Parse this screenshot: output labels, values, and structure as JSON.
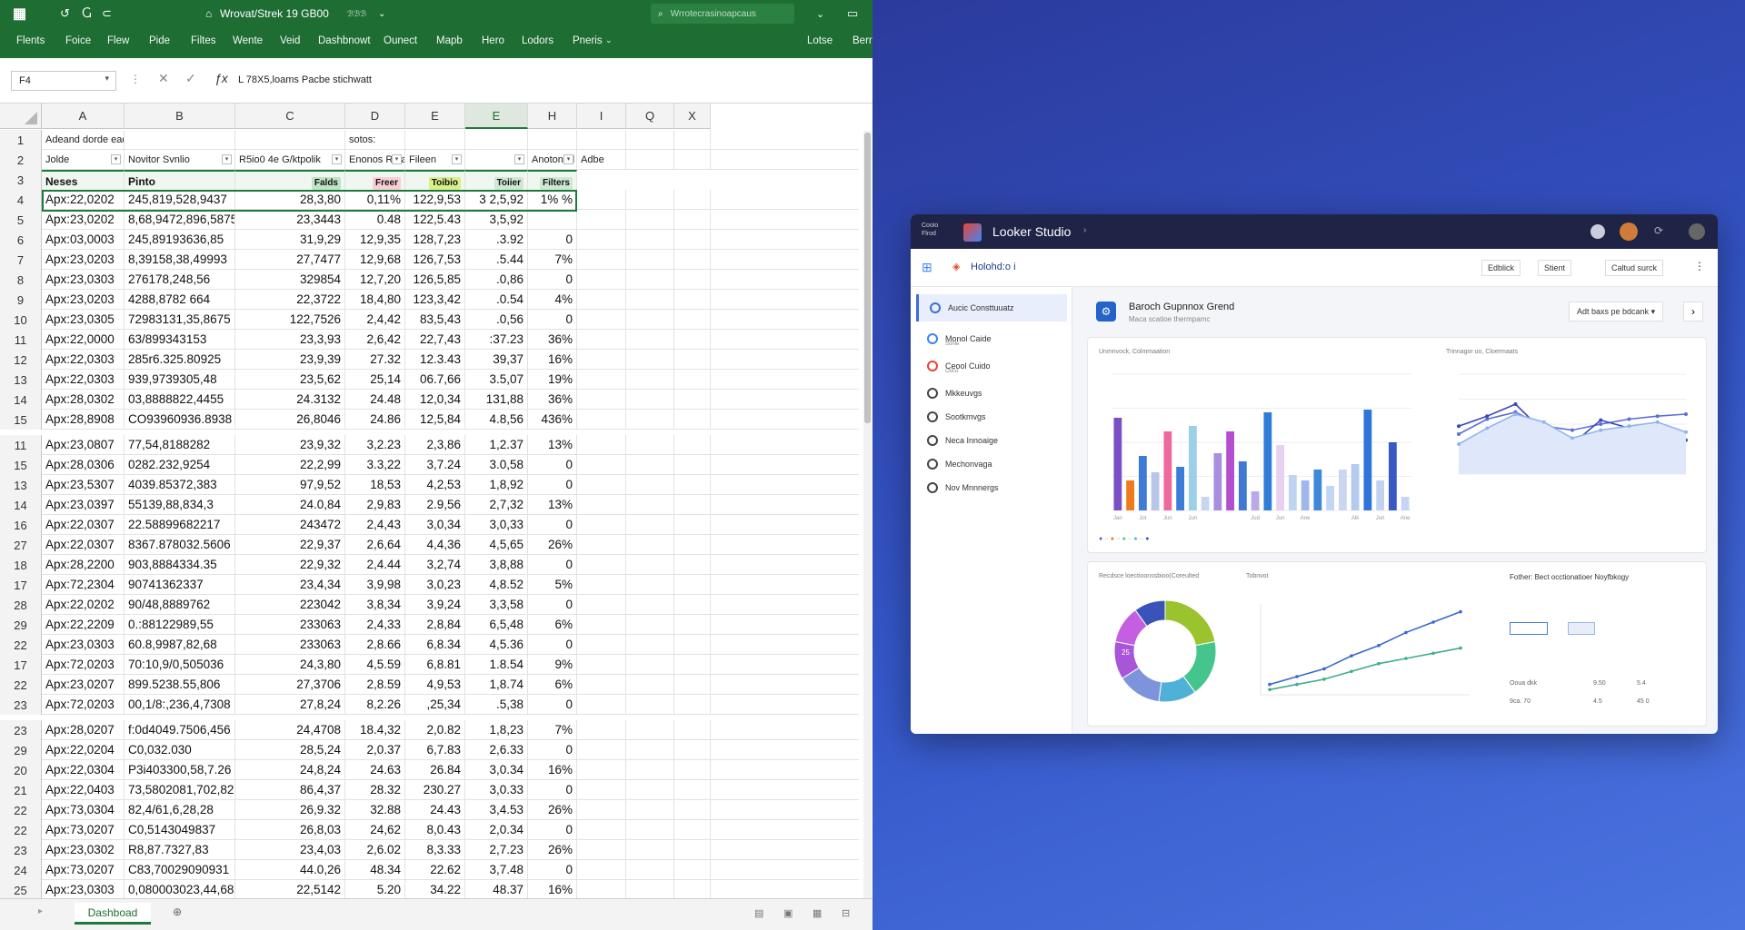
{
  "excel": {
    "title": "Wrovat/Strek 19 GB00",
    "title_badge": "ℬℬℬ",
    "search_placeholder": "Wrrotecrasinoapcaus",
    "menu": [
      "Flents",
      "Foice",
      "Flew",
      "Pide",
      "Filtes",
      "Wente",
      "Veid",
      "Dashbnowt",
      "Ounect",
      "Mapb",
      "Hero",
      "Lodors",
      "Pneris"
    ],
    "menu_right": [
      "Lotse",
      "Berr"
    ],
    "name_box": "F4",
    "formula": "L 78X5,loams Pacbe stichwatt",
    "columns": [
      "A",
      "B",
      "C",
      "D",
      "E",
      "E",
      "H",
      "I",
      "Q",
      "X"
    ],
    "row1": [
      "Adeand dorde eadas",
      "",
      "",
      "sotos:"
    ],
    "row2": [
      "Jolde",
      "Novitor Svnlio",
      "R5io0 4e G/ktpolik",
      "Enonos Rotay",
      "Fileen",
      "",
      "Anotonad",
      "Adbe"
    ],
    "row3": {
      "a": "Neses",
      "b": "Pinto",
      "c": "Falds",
      "d": "Freer",
      "e": "Toibio",
      "f": "Toiier",
      "g": "Filters"
    },
    "rows": [
      {
        "n": "4",
        "a": "Apx:22,0202",
        "b": "245,819,528,9437",
        "c": "28,3,80",
        "d": "0,11%",
        "e": "122,9,53",
        "f": "3 2,5,92",
        "g": "1% %"
      },
      {
        "n": "5",
        "a": "Apx:23,0202",
        "b": "8,68,9472,896,5875",
        "c": "23,3443",
        "d": "0.48",
        "e": "122,5.43",
        "f": "3,5,92",
        "g": ""
      },
      {
        "n": "6",
        "a": "Apx:03,0003",
        "b": "245,89193636,85",
        "c": "31,9,29",
        "d": "12,9,35",
        "e": "128,7,23",
        "f": ".3.92",
        "g": "0"
      },
      {
        "n": "7",
        "a": "Apx:23,0203",
        "b": "8,39158,38,49993",
        "c": "27,7477",
        "d": "12,9,68",
        "e": "126,7,53",
        "f": ".5.44",
        "g": "7%"
      },
      {
        "n": "8",
        "a": "Apx:23,0303",
        "b": "276178,248,56",
        "c": "329854",
        "d": "12,7,20",
        "e": "126,5,85",
        "f": ".0,86",
        "g": "0"
      },
      {
        "n": "9",
        "a": "Apx:23,0203",
        "b": "4288,8782 664",
        "c": "22,3722",
        "d": "18,4,80",
        "e": "123,3,42",
        "f": ".0.54",
        "g": "4%"
      },
      {
        "n": "10",
        "a": "Apx:23,0305",
        "b": "72983131,35,8675",
        "c": "122,7526",
        "d": "2,4,42",
        "e": "83,5,43",
        "f": ".0,56",
        "g": "0"
      },
      {
        "n": "11",
        "a": "Apx:22,0000",
        "b": "63/899343153",
        "c": "23,3,93",
        "d": "2,6,42",
        "e": "22,7,43",
        "f": ":37.23",
        "g": "36%"
      },
      {
        "n": "12",
        "a": "Apx:22,0303",
        "b": "285r6.325.80925",
        "c": "23,9,39",
        "d": "27.32",
        "e": "12.3.43",
        "f": "39,37",
        "g": "16%"
      },
      {
        "n": "13",
        "a": "Apx:22,0303",
        "b": "939,9739305,48",
        "c": "23,5,62",
        "d": "25,14",
        "e": "06.7,66",
        "f": "3.5,07",
        "g": "19%"
      },
      {
        "n": "14",
        "a": "Apx:28,0302",
        "b": "03,8888822,4455",
        "c": "24.3132",
        "d": "24.48",
        "e": "12,0,34",
        "f": "131,88",
        "g": "36%"
      },
      {
        "n": "15",
        "a": "Apx:28,8908",
        "b": "CO93960936.8938",
        "c": "26,8046",
        "d": "24.86",
        "e": "12,5,84",
        "f": "4.8,56",
        "g": "436%"
      },
      {
        "n": "11",
        "a": "Apx:23,0807",
        "b": "77,54,8188282",
        "c": "23,9,32",
        "d": "3,2.23",
        "e": "2,3,86",
        "f": "1,2.37",
        "g": "13%"
      },
      {
        "n": "15",
        "a": "Apx:28,0306",
        "b": "0282.232,9254",
        "c": "22,2,99",
        "d": "3.3,22",
        "e": "3,7.24",
        "f": "3.0,58",
        "g": "0"
      },
      {
        "n": "13",
        "a": "Apx:23,5307",
        "b": "4039.85372,383",
        "c": "97,9,52",
        "d": "18,53",
        "e": "4,2,53",
        "f": "1,8,92",
        "g": "0"
      },
      {
        "n": "14",
        "a": "Apx:23,0397",
        "b": "55139,88,834,3",
        "c": "24.0,84",
        "d": "2,9,83",
        "e": "2.9,56",
        "f": "2,7,32",
        "g": "13%"
      },
      {
        "n": "16",
        "a": "Apx:22,0307",
        "b": "22.58899682217",
        "c": "243472",
        "d": "2,4,43",
        "e": "3,0,34",
        "f": "3,0,33",
        "g": "0"
      },
      {
        "n": "27",
        "a": "Apx:22,0307",
        "b": "8367.878032.5606",
        "c": "22,9,37",
        "d": "2,6,64",
        "e": "4,4,36",
        "f": "4,5,65",
        "g": "26%"
      },
      {
        "n": "18",
        "a": "Apx:28,2200",
        "b": "903,8884334.35",
        "c": "22,9,32",
        "d": "2,4.44",
        "e": "3,2,74",
        "f": "3,8,88",
        "g": "0"
      },
      {
        "n": "17",
        "a": "Apx:72,2304",
        "b": "90741362337",
        "c": "23,4,34",
        "d": "3,9,98",
        "e": "3,0,23",
        "f": "4,8.52",
        "g": "5%"
      },
      {
        "n": "28",
        "a": "Apx:22,0202",
        "b": "90/48,8889762",
        "c": "223042",
        "d": "3,8,34",
        "e": "3,9,24",
        "f": "3,3,58",
        "g": "0"
      },
      {
        "n": "29",
        "a": "Apx:22,2209",
        "b": "0.:88122989,55",
        "c": "233063",
        "d": "2,4,33",
        "e": "2,8,84",
        "f": "6,5,48",
        "g": "6%"
      },
      {
        "n": "22",
        "a": "Apx:23,0303",
        "b": "60.8,9987,82,68",
        "c": "233063",
        "d": "2,8.66",
        "e": "6,8.34",
        "f": "4,5.36",
        "g": "0"
      },
      {
        "n": "17",
        "a": "Apx:72,0203",
        "b": "70:10,9/0,505036",
        "c": "24,3,80",
        "d": "4,5.59",
        "e": "6,8.81",
        "f": "1.8.54",
        "g": "9%"
      },
      {
        "n": "22",
        "a": "Apx:23,0207",
        "b": "899.5238.55,806",
        "c": "27,3706",
        "d": "2,8.59",
        "e": "4,9,53",
        "f": "1,8.74",
        "g": "6%"
      },
      {
        "n": "23",
        "a": "Apx:72,0203",
        "b": "00,1/8:,236,4,7308",
        "c": "27,8,24",
        "d": "8,2.26",
        "e": ",25,34",
        "f": ".5,38",
        "g": "0"
      },
      {
        "n": "23",
        "a": "Apx:28,0207",
        "b": "f:0d4049.7506,456",
        "c": "24,4708",
        "d": "18.4,32",
        "e": "2,0.82",
        "f": "1,8,23",
        "g": "7%"
      },
      {
        "n": "29",
        "a": "Apx:22,0204",
        "b": "C0,032.030",
        "c": "28,5,24",
        "d": "2,0.37",
        "e": "6,7.83",
        "f": "2,6.33",
        "g": "0"
      },
      {
        "n": "20",
        "a": "Apx:22,0304",
        "b": "P3i403300,58,7.26",
        "c": "24,8,24",
        "d": "24.63",
        "e": "26.84",
        "f": "3,0.34",
        "g": "16%"
      },
      {
        "n": "21",
        "a": "Apx:22,0403",
        "b": "73,5802081,702,82,06",
        "c": "86,4,37",
        "d": "28.32",
        "e": "230.27",
        "f": "3,0.33",
        "g": "0"
      },
      {
        "n": "22",
        "a": "Apx:73,0304",
        "b": "82,4/61,6,28,28",
        "c": "26,9.32",
        "d": "32.88",
        "e": "24.43",
        "f": "3,4.53",
        "g": "26%"
      },
      {
        "n": "22",
        "a": "Apx:73,0207",
        "b": "C0,5143049837",
        "c": "26,8,03",
        "d": "24,62",
        "e": "8,0.43",
        "f": "2,0.34",
        "g": "0"
      },
      {
        "n": "23",
        "a": "Apx:23,0302",
        "b": "R8,87.7327,83",
        "c": "23,4,03",
        "d": "2,6.02",
        "e": "8,3.33",
        "f": "2,7.23",
        "g": "26%"
      },
      {
        "n": "24",
        "a": "Apx:73,0207",
        "b": "C83,70029090931",
        "c": "44.0,26",
        "d": "48.34",
        "e": "22.62",
        "f": "3,7.48",
        "g": "0"
      },
      {
        "n": "25",
        "a": "Apx:23,0303",
        "b": "0,080003023,44,681",
        "c": "22,5142",
        "d": "5.20",
        "e": "34.22",
        "f": "48.37",
        "g": "16%"
      }
    ],
    "sheet_tab": "Dashboad"
  },
  "looker": {
    "brand_small": "Coolo Flrod",
    "title": "Looker Studio",
    "report_name": "Holohd:o i",
    "tool_buttons": [
      "Edblick",
      "Stient",
      "Caltud surck"
    ],
    "sidebar": [
      {
        "label": "Aucic Consttuuatz",
        "sub": "",
        "color": "#3b6fd6"
      },
      {
        "label": "Monol Caide",
        "sub": "Sonie",
        "color": "#3b82f6"
      },
      {
        "label": "Ceool Cuido",
        "sub": "Ooco",
        "color": "#ea4335"
      },
      {
        "label": "Mkkeuvgs",
        "sub": "",
        "color": "#444"
      },
      {
        "label": "Sootkmvgs",
        "sub": "",
        "color": "#444"
      },
      {
        "label": "Neca Innoaige",
        "sub": "",
        "color": "#444"
      },
      {
        "label": "Mechonvaga",
        "sub": "",
        "color": "#444"
      },
      {
        "label": "Nov Mnnnergs",
        "sub": "",
        "color": "#444"
      }
    ],
    "page_title": "Baroch Gupnnox Grend",
    "page_sub": "Maca scatioe thermpamc",
    "page_action": "Adt baxs pe bdcank",
    "panel1": {
      "title": "Unmnvock, Colmmaation",
      "right_title": "Trinnagor uo, Cloermaats"
    },
    "panel2": {
      "title": "Recdsce loectioonssbioo(Coreulted",
      "mid_title": "Tobnvot",
      "right_title": "Fother: Bect occtionatioer Noyfbkogy"
    },
    "chart_data": [
      {
        "type": "bar",
        "title": "",
        "categories": [
          "Jan",
          "",
          "Jot",
          "",
          "Jun",
          "",
          "Jun",
          "",
          "",
          "",
          "",
          "Jud",
          "",
          "Jun",
          "",
          "Ane",
          "",
          "",
          "",
          "Alk",
          "",
          "Jun",
          "",
          "Ane"
        ],
        "series": [
          {
            "name": "",
            "values": [
              68,
              22,
              40,
              28,
              58,
              32,
              62,
              10,
              42,
              58,
              36,
              14,
              72,
              48,
              26,
              22,
              30,
              18,
              30,
              34,
              74,
              22,
              50,
              10
            ]
          }
        ],
        "colors": [
          "#7b4fc4",
          "#ef7a1a",
          "#3d7bd6",
          "#b8c6e8",
          "#ee6a9e",
          "#3b7dd8",
          "#9ccfe8",
          "#c6d5f0",
          "#a88fe0",
          "#b34fcf",
          "#3f79d4",
          "#b9a9ea",
          "#2f7cd9",
          "#e8d0f0",
          "#c0d4f2",
          "#9fb7ea",
          "#3e87d9",
          "#c0d6f5",
          "#cad6f0",
          "#b4cbef",
          "#2f74d8",
          "#c2d3f2",
          "#3a58c4",
          "#c7d5f5"
        ],
        "ylim": [
          0,
          100
        ]
      },
      {
        "type": "line",
        "title": "",
        "series": [
          {
            "name": "",
            "values": [
              40,
              55,
              62,
              48,
              44,
              50,
              55,
              58,
              60
            ]
          },
          {
            "name": "",
            "values": [
              48,
              58,
              70,
              42,
              30,
              54,
              46,
              40,
              34
            ]
          },
          {
            "name": "",
            "values": [
              30,
              46,
              60,
              52,
              36,
              44,
              48,
              52,
              42
            ]
          }
        ],
        "ylim": [
          0,
          100
        ]
      },
      {
        "type": "pie",
        "title": "",
        "slices": [
          {
            "label": "",
            "value": 22,
            "color": "#9ac32d"
          },
          {
            "label": "",
            "value": 18,
            "color": "#45c58c"
          },
          {
            "label": "",
            "value": 12,
            "color": "#4fb0d8"
          },
          {
            "label": "",
            "value": 14,
            "color": "#7d93dc"
          },
          {
            "label": "",
            "value": 12,
            "color": "#a855d8"
          },
          {
            "label": "",
            "value": 12,
            "color": "#c35fe0"
          },
          {
            "label": "",
            "value": 10,
            "color": "#3a53b8"
          }
        ]
      },
      {
        "type": "line",
        "title": "",
        "series": [
          {
            "name": "",
            "values": [
              8,
              14,
              20,
              30,
              38,
              48,
              56,
              64
            ]
          },
          {
            "name": "",
            "values": [
              4,
              8,
              12,
              18,
              24,
              28,
              32,
              36
            ]
          }
        ],
        "ylim": [
          0,
          70
        ]
      }
    ],
    "pie_center": "25",
    "filters": {
      "rows": [
        [
          "Ooua dkk",
          "9.50",
          "5.4"
        ],
        [
          "9ca. 70",
          "4.5",
          "45 0"
        ]
      ]
    }
  }
}
